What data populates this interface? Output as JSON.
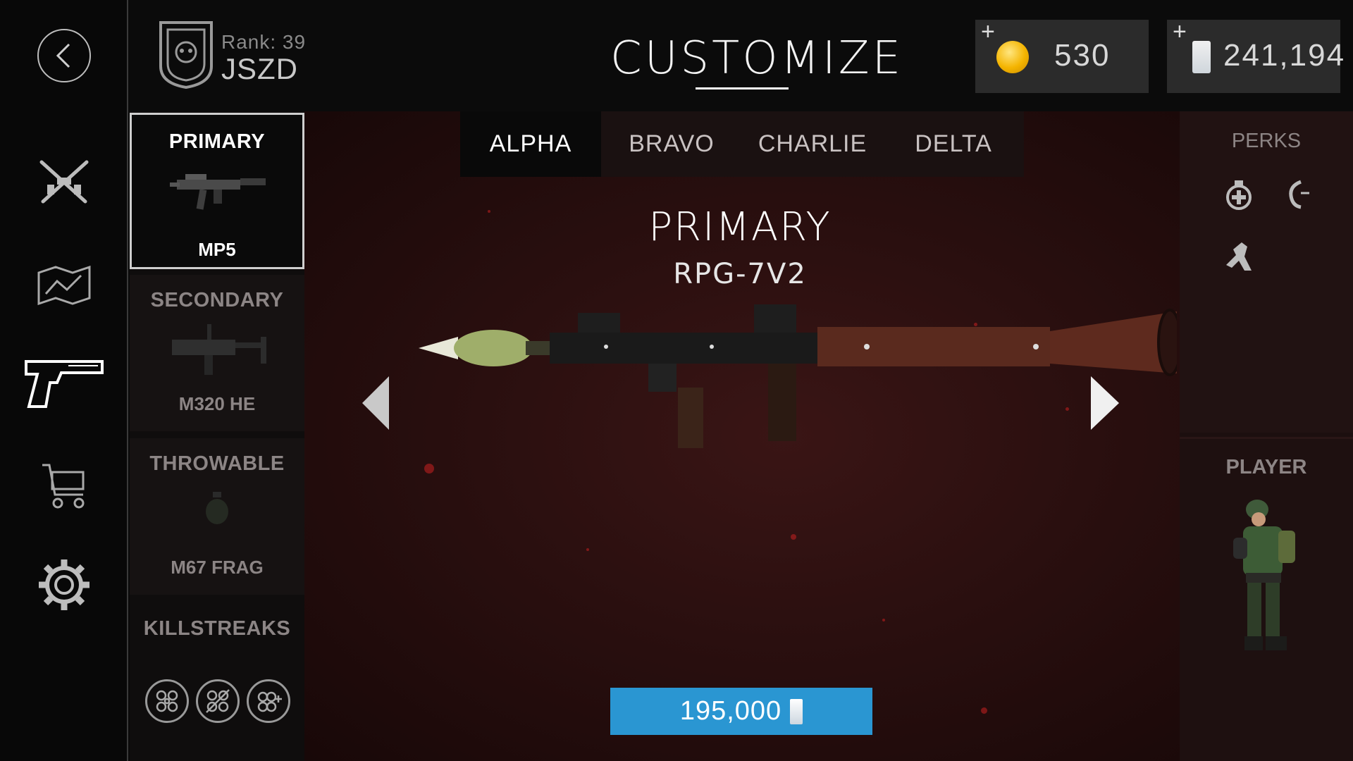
{
  "header": {
    "rank_label": "Rank: 39",
    "player_name": "JSZD",
    "title": "CUSTOMIZE"
  },
  "currency": {
    "gold": {
      "plus": "+",
      "value": "530",
      "icon": "gold-coin-icon"
    },
    "cash": {
      "plus": "+",
      "value": "241,194",
      "icon": "cash-icon"
    }
  },
  "rail": {
    "items": [
      {
        "icon": "back-arrow-icon"
      },
      {
        "icon": "crossed-rifles-icon"
      },
      {
        "icon": "map-icon"
      },
      {
        "icon": "pistol-icon"
      },
      {
        "icon": "cart-icon"
      },
      {
        "icon": "gear-icon"
      }
    ]
  },
  "loadout": {
    "primary": {
      "title": "PRIMARY",
      "name": "MP5"
    },
    "secondary": {
      "title": "SECONDARY",
      "name": "M320 HE"
    },
    "throwable": {
      "title": "THROWABLE",
      "name": "M67 FRAG"
    },
    "killstreaks": {
      "title": "KILLSTREAKS",
      "icons": [
        "drone-icon",
        "drone-disabled-icon",
        "drone-plus-icon"
      ]
    }
  },
  "tabs": [
    {
      "label": "ALPHA",
      "active": true
    },
    {
      "label": "BRAVO",
      "active": false
    },
    {
      "label": "CHARLIE",
      "active": false
    },
    {
      "label": "DELTA",
      "active": false
    }
  ],
  "weapon": {
    "category": "PRIMARY",
    "name": "RPG-7V2",
    "price": "195,000",
    "price_icon": "cash-icon"
  },
  "perks": {
    "title": "PERKS",
    "icons": [
      "medkit-icon",
      "grenade-throw-icon",
      "sprint-icon"
    ]
  },
  "player": {
    "title": "PLAYER"
  },
  "colors": {
    "accent_blue": "#2a96d2",
    "background": "#2a0f0f",
    "gold": "#f4b400"
  }
}
